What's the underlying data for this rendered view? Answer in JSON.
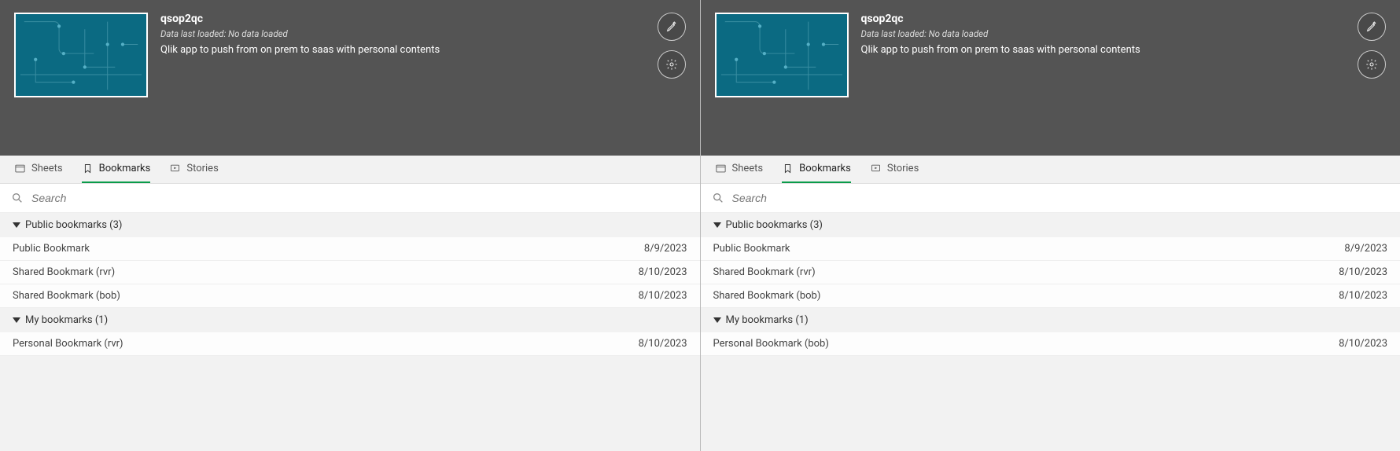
{
  "panels": [
    {
      "app_title": "qsop2qc",
      "data_loaded": "Data last loaded: No data loaded",
      "description": "Qlik app to push from on prem to saas with personal contents",
      "tabs": {
        "sheets": "Sheets",
        "bookmarks": "Bookmarks",
        "stories": "Stories"
      },
      "search_placeholder": "Search",
      "sections": {
        "public": {
          "label": "Public bookmarks (3)",
          "items": [
            {
              "name": "Public Bookmark",
              "date": "8/9/2023"
            },
            {
              "name": "Shared Bookmark (rvr)",
              "date": "8/10/2023"
            },
            {
              "name": "Shared Bookmark (bob)",
              "date": "8/10/2023"
            }
          ]
        },
        "mine": {
          "label": "My bookmarks (1)",
          "items": [
            {
              "name": "Personal Bookmark (rvr)",
              "date": "8/10/2023"
            }
          ]
        }
      }
    },
    {
      "app_title": "qsop2qc",
      "data_loaded": "Data last loaded: No data loaded",
      "description": "Qlik app to push from on prem to saas with personal contents",
      "tabs": {
        "sheets": "Sheets",
        "bookmarks": "Bookmarks",
        "stories": "Stories"
      },
      "search_placeholder": "Search",
      "sections": {
        "public": {
          "label": "Public bookmarks (3)",
          "items": [
            {
              "name": "Public Bookmark",
              "date": "8/9/2023"
            },
            {
              "name": "Shared Bookmark (rvr)",
              "date": "8/10/2023"
            },
            {
              "name": "Shared Bookmark (bob)",
              "date": "8/10/2023"
            }
          ]
        },
        "mine": {
          "label": "My bookmarks (1)",
          "items": [
            {
              "name": "Personal Bookmark (bob)",
              "date": "8/10/2023"
            }
          ]
        }
      }
    }
  ]
}
